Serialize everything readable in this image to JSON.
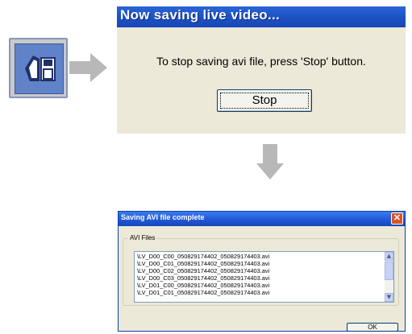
{
  "colors": {
    "xp_title_blue": "#1c4fc2",
    "dialog_face": "#ece9d8",
    "arrow_gray": "#b8b8b8",
    "icon_blue": "#5f82c8"
  },
  "icons": {
    "toolbar": "save-avi-icon",
    "flow_right": "arrow-right-icon",
    "flow_down": "arrow-down-icon",
    "close": "close-icon"
  },
  "saving_dialog": {
    "title": "Now saving live video...",
    "message": "To stop saving avi file, press 'Stop' button.",
    "stop_label": "Stop"
  },
  "complete_dialog": {
    "title": "Saving AVI file complete",
    "close_label": "✕",
    "group_label": "AVI Files",
    "files": [
      "\\LV_D00_C00_050829174402_050829174403.avi",
      "\\LV_D00_C01_050829174402_050829174403.avi",
      "\\LV_D00_C02_050829174402_050829174403.avi",
      "\\LV_D00_C03_050829174402_050829174403.avi",
      "\\LV_D01_C00_050829174402_050829174403.avi",
      "\\LV_D01_C01_050829174402_050829174403.avi"
    ],
    "ok_label": "OK"
  }
}
